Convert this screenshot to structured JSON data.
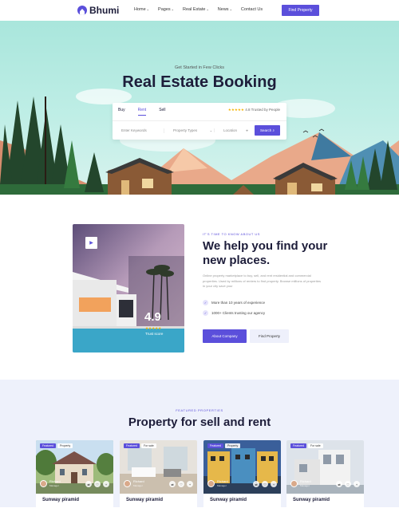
{
  "brand": {
    "name": "Bhumi",
    "accent": "#5b4fdb"
  },
  "nav": {
    "items": [
      {
        "label": "Home",
        "chev": true,
        "active": true
      },
      {
        "label": "Pages",
        "chev": true
      },
      {
        "label": "Real Estate",
        "chev": true
      },
      {
        "label": "News",
        "chev": true
      },
      {
        "label": "Contact Us",
        "chev": false
      }
    ],
    "cta": "Find Property"
  },
  "hero": {
    "kicker": "Get Started in Few Clicks",
    "title": "Real Estate Booking",
    "search": {
      "tabs": [
        "Buy",
        "Rent",
        "Sell"
      ],
      "active_tab": "Rent",
      "stars": "★★★★★",
      "rating_text": "4.8 Trusted by People",
      "field1": "Enter Keywords",
      "field2": "Property Types",
      "field3": "Location",
      "button": "Search"
    }
  },
  "about": {
    "score": "4.9",
    "score_stars": "★★★★★",
    "score_label": "Trust score",
    "kicker": "IT'S TIME TO KNOW ABOUT US",
    "title": "We help you find your new places.",
    "description": "Online property marketplace to buy, sell, and rent residential and commercial properties. Used by millions of renters to find property. Browse millions of properties in your city save your",
    "checks": [
      "More than 10 years of experience",
      "1000+ Clients trusting our agency"
    ],
    "btn_primary": "About Company",
    "btn_secondary": "Find Property"
  },
  "featured": {
    "kicker": "FEATURED PROPERTIES",
    "title": "Property for sell and rent",
    "cards": [
      {
        "badge1": "Featured",
        "badge2": "Property",
        "agent": "Richard",
        "agent_role": "Manager",
        "name": "Sunway piramid"
      },
      {
        "badge1": "Featured",
        "badge2": "For sale",
        "agent": "Richard",
        "agent_role": "Manager",
        "name": "Sunway piramid"
      },
      {
        "badge1": "Featured",
        "badge2": "Property",
        "agent": "Richard",
        "agent_role": "Manager",
        "name": "Sunway piramid"
      },
      {
        "badge1": "Featured",
        "badge2": "For sale",
        "agent": "Richard",
        "agent_role": "Manager",
        "name": "Sunway piramid"
      }
    ]
  }
}
